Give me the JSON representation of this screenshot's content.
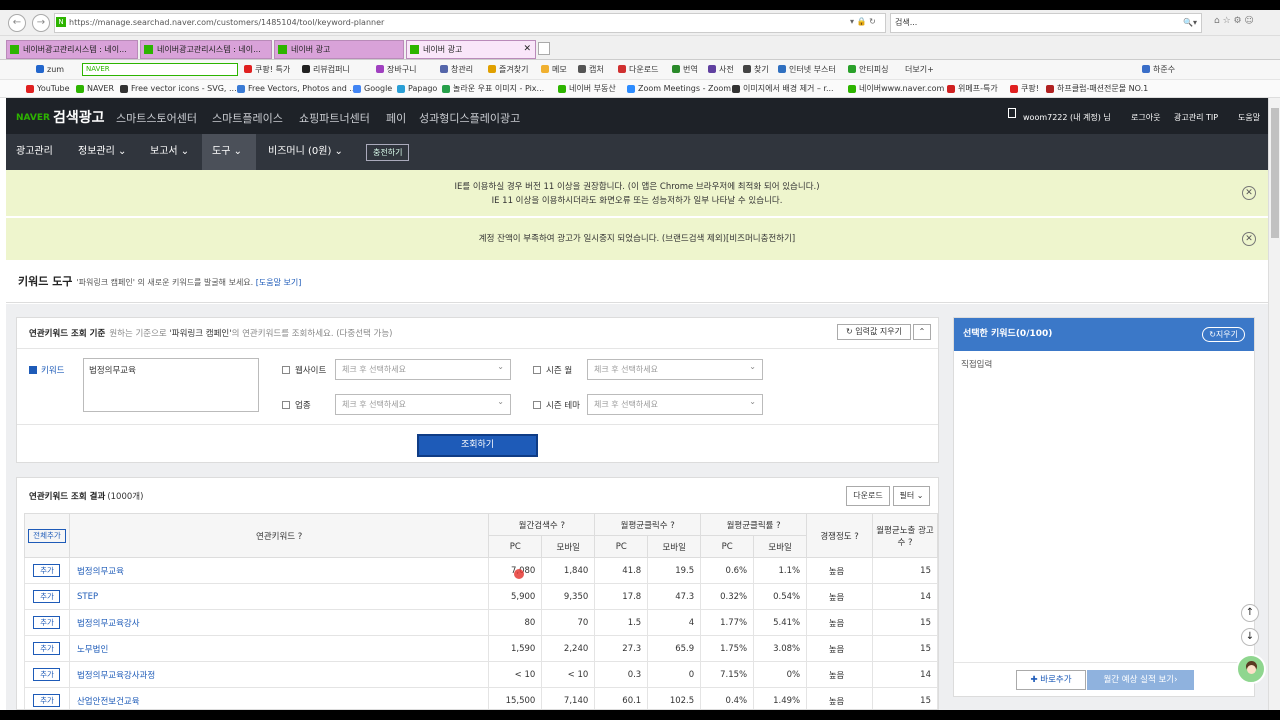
{
  "browser": {
    "url": "https://manage.searchad.naver.com/customers/1485104/tool/keyword-planner",
    "search_placeholder": "검색...",
    "url_icons": "▾ 🔒 ↻",
    "search_icons": "🔍▾",
    "tools_icons": "⌂ ☆ ⚙ ☺",
    "back": "←",
    "fwd": "→",
    "win": "—   ❐   ✕"
  },
  "tabs": [
    "네이버광고관리시스템 : 네이...",
    "네이버광고관리시스템 : 네이...",
    "네이버 광고",
    "네이버 광고"
  ],
  "tab_close": "✕",
  "bookmarks1": [
    "zum",
    "NAVER",
    "쿠팡! 특가",
    "리뷰컴퍼니",
    "장바구니",
    "창관리",
    "즐겨찾기",
    "메모",
    "캡처",
    "다운로드",
    "번역",
    "사전",
    "찾기",
    "인터넷 부스터",
    "안티피싱",
    "더보기+",
    "하준수"
  ],
  "bookmarks2": [
    "YouTube",
    "NAVER",
    "Free vector icons - SVG, ...",
    "Free Vectors, Photos and ...",
    "Google",
    "Papago",
    "놀라운 우표 이미지 - Pix...",
    "네이버 부동산",
    "Zoom Meetings - Zoom",
    "이미지에서 배경 제거 – r...",
    "네이버www.naver.com",
    "위메프-특가",
    "쿠팡!",
    "하프클럽-패션전문몰 NO.1"
  ],
  "header": {
    "naver": "NAVER",
    "brand": "검색광고",
    "nav": [
      "스마트스토어센터",
      "스마트플레이스",
      "쇼핑파트너센터",
      "페이",
      "성과형디스플레이광고"
    ],
    "account": "woom7222 (내 계정) 님",
    "logout": "로그아웃",
    "tip": "광고관리 TIP",
    "help": "도움말"
  },
  "menu": {
    "items": [
      "광고관리",
      "정보관리 ⌄",
      "보고서 ⌄",
      "도구 ⌄",
      "비즈머니 (0원) ⌄"
    ],
    "charge": "충전하기"
  },
  "notice1": {
    "line1": "IE를 이용하실 경우 버전 11 이상을 권장합니다. (이 앱은 Chrome 브라우저에 최적화 되어 있습니다.)",
    "line2": "IE 11 이상을 이용하시더라도 화면오류 또는 성능저하가 일부 나타날 수 있습니다."
  },
  "notice2": "계정 잔액이 부족하여 광고가 일시중지 되었습니다. (브랜드검색 제외)[비즈머니충전하기]",
  "tool": {
    "title": "키워드 도구",
    "campaign": "'파워링크 캠페인'",
    "desc": "의 새로운 키워드를 발굴해 보세요.",
    "help": "[도움말 보기]"
  },
  "criteria": {
    "title": "연관키워드 조회 기준",
    "desc1": "원하는 기준으로",
    "campaign": "'파워링크 캠페인'",
    "desc2": "의 연관키워드를 조회하세요. (다중선택 가능)",
    "reset": "↻ 입력값 지우기",
    "collapse": "⌃",
    "keyword_label": "키워드",
    "keyword_value": "법정의무교육",
    "website": "웹사이트",
    "industry": "업종",
    "season_month": "시즌 월",
    "season_theme": "시즌 테마",
    "select_placeholder": "체크 후 선택하세요",
    "search": "조회하기"
  },
  "results": {
    "title": "연관키워드 조회 결과",
    "count": "(1000개)",
    "download": "다운로드",
    "filter": "필터 ⌄",
    "add_all": "전체추가",
    "col_keyword": "연관키워드 ?",
    "col_search": "월간검색수 ?",
    "col_clicks": "월평균클릭수 ?",
    "col_ctr": "월평균클릭률 ?",
    "col_comp": "경쟁정도 ?",
    "col_ads": "월평균노출 광고수 ?",
    "sub": [
      "PC",
      "모바일",
      "PC",
      "모바일",
      "PC",
      "모바일"
    ],
    "add": "추가",
    "rows": [
      [
        "법정의무교육",
        "7,080",
        "1,840",
        "41.8",
        "19.5",
        "0.6%",
        "1.1%",
        "높음",
        "15"
      ],
      [
        "STEP",
        "5,900",
        "9,350",
        "17.8",
        "47.3",
        "0.32%",
        "0.54%",
        "높음",
        "14"
      ],
      [
        "법정의무교육강사",
        "80",
        "70",
        "1.5",
        "4",
        "1.77%",
        "5.41%",
        "높음",
        "15"
      ],
      [
        "노무법인",
        "1,590",
        "2,240",
        "27.3",
        "65.9",
        "1.75%",
        "3.08%",
        "높음",
        "15"
      ],
      [
        "법정의무교육강사과정",
        "< 10",
        "< 10",
        "0.3",
        "0",
        "7.15%",
        "0%",
        "높음",
        "14"
      ],
      [
        "산업안전보건교육",
        "15,500",
        "7,140",
        "60.1",
        "102.5",
        "0.4%",
        "1.49%",
        "높음",
        "15"
      ]
    ]
  },
  "selected": {
    "title": "선택한 키워드(0/100)",
    "clear": "↻지우기",
    "direct": "직접입력",
    "add": "✚ 바로추가",
    "forecast": "월간 예상 실적 보기›"
  },
  "scroll": {
    "up": "↑",
    "down": "↓"
  }
}
